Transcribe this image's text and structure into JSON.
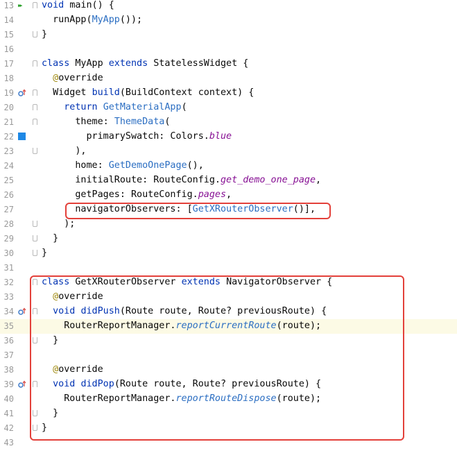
{
  "colors": {
    "keyword": "#0033b3",
    "class": "#00627a",
    "constructor": "#2b6ec2",
    "annotation": "#9e880d",
    "highlight_box": "#e3403a",
    "current_line": "#fcfae5"
  },
  "lines": [
    {
      "n": "13",
      "icon": "run-icon",
      "tokens": [
        [
          "kw",
          "void "
        ],
        [
          "plain",
          "main() {"
        ]
      ]
    },
    {
      "n": "14",
      "tokens": [
        [
          "plain",
          "  runApp("
        ],
        [
          "ctor",
          "MyApp"
        ],
        [
          "plain",
          "());"
        ]
      ]
    },
    {
      "n": "15",
      "tokens": [
        [
          "plain",
          "}"
        ]
      ]
    },
    {
      "n": "16",
      "tokens": []
    },
    {
      "n": "17",
      "tokens": [
        [
          "kw",
          "class "
        ],
        [
          "plain",
          "MyApp "
        ],
        [
          "kw",
          "extends "
        ],
        [
          "plain",
          "StatelessWidget {"
        ]
      ]
    },
    {
      "n": "18",
      "tokens": [
        [
          "meta",
          "  @"
        ],
        [
          "plain",
          "override"
        ]
      ]
    },
    {
      "n": "19",
      "icon": "override-icon",
      "tokens": [
        [
          "plain",
          "  Widget "
        ],
        [
          "kw",
          "build"
        ],
        [
          "plain",
          "(BuildContext context) {"
        ]
      ]
    },
    {
      "n": "20",
      "tokens": [
        [
          "kw",
          "    return "
        ],
        [
          "ctor",
          "GetMaterialApp"
        ],
        [
          "plain",
          "("
        ]
      ]
    },
    {
      "n": "21",
      "tokens": [
        [
          "plain",
          "      theme: "
        ],
        [
          "ctor",
          "ThemeData"
        ],
        [
          "plain",
          "("
        ]
      ]
    },
    {
      "n": "22",
      "icon": "color-swatch",
      "tokens": [
        [
          "plain",
          "        primarySwatch: Colors."
        ],
        [
          "stat",
          "blue"
        ]
      ]
    },
    {
      "n": "23",
      "tokens": [
        [
          "plain",
          "      ),"
        ]
      ]
    },
    {
      "n": "24",
      "tokens": [
        [
          "plain",
          "      home: "
        ],
        [
          "ctor",
          "GetDemoOnePage"
        ],
        [
          "plain",
          "(),"
        ]
      ]
    },
    {
      "n": "25",
      "tokens": [
        [
          "plain",
          "      initialRoute: RouteConfig."
        ],
        [
          "stat",
          "get_demo_one_page"
        ],
        [
          "plain",
          ","
        ]
      ]
    },
    {
      "n": "26",
      "tokens": [
        [
          "plain",
          "      getPages: RouteConfig."
        ],
        [
          "stat",
          "pages"
        ],
        [
          "plain",
          ","
        ]
      ]
    },
    {
      "n": "27",
      "tokens": [
        [
          "plain",
          "      navigatorObservers: ["
        ],
        [
          "ctor",
          "GetXRouterObserver"
        ],
        [
          "plain",
          "()],"
        ]
      ]
    },
    {
      "n": "28",
      "tokens": [
        [
          "plain",
          "    );"
        ]
      ]
    },
    {
      "n": "29",
      "tokens": [
        [
          "plain",
          "  }"
        ]
      ]
    },
    {
      "n": "30",
      "tokens": [
        [
          "plain",
          "}"
        ]
      ]
    },
    {
      "n": "31",
      "tokens": []
    },
    {
      "n": "32",
      "tokens": [
        [
          "kw",
          "class "
        ],
        [
          "plain",
          "GetXRouterObserver "
        ],
        [
          "kw",
          "extends "
        ],
        [
          "plain",
          "NavigatorObserver {"
        ]
      ]
    },
    {
      "n": "33",
      "tokens": [
        [
          "meta",
          "  @"
        ],
        [
          "plain",
          "override"
        ]
      ]
    },
    {
      "n": "34",
      "icon": "override-icon",
      "tokens": [
        [
          "kw",
          "  void "
        ],
        [
          "kw",
          "didPush"
        ],
        [
          "plain",
          "(Route route, Route? previousRoute) {"
        ]
      ]
    },
    {
      "n": "35",
      "current": true,
      "tokens": [
        [
          "plain",
          "    RouterReportManager."
        ],
        [
          "sfn",
          "reportCurrentRoute"
        ],
        [
          "plain",
          "(route);"
        ]
      ]
    },
    {
      "n": "36",
      "tokens": [
        [
          "plain",
          "  }"
        ]
      ]
    },
    {
      "n": "37",
      "tokens": []
    },
    {
      "n": "38",
      "tokens": [
        [
          "meta",
          "  @"
        ],
        [
          "plain",
          "override"
        ]
      ]
    },
    {
      "n": "39",
      "icon": "override-icon",
      "tokens": [
        [
          "kw",
          "  void "
        ],
        [
          "kw",
          "didPop"
        ],
        [
          "plain",
          "(Route route, Route? previousRoute) {"
        ]
      ]
    },
    {
      "n": "40",
      "tokens": [
        [
          "plain",
          "    RouterReportManager."
        ],
        [
          "sfn",
          "reportRouteDispose"
        ],
        [
          "plain",
          "(route);"
        ]
      ]
    },
    {
      "n": "41",
      "tokens": [
        [
          "plain",
          "  }"
        ]
      ]
    },
    {
      "n": "42",
      "tokens": [
        [
          "plain",
          "}"
        ]
      ]
    },
    {
      "n": "43",
      "tokens": []
    }
  ]
}
